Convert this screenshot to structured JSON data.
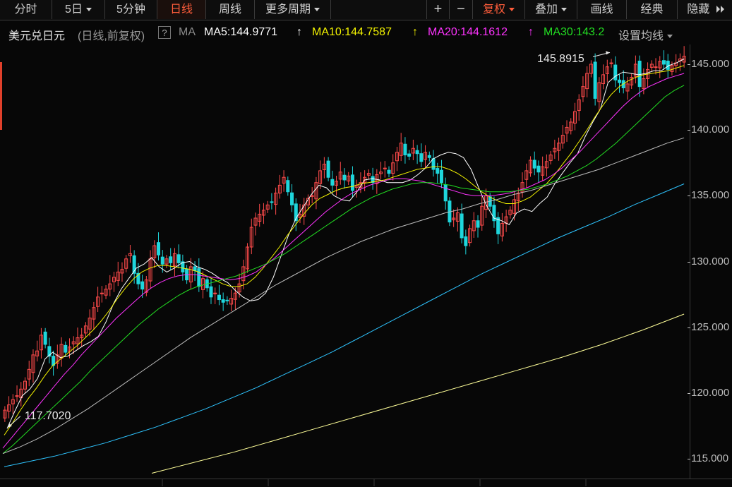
{
  "toolbar": {
    "left_buttons": [
      {
        "label": "分时",
        "dropdown": false,
        "active": false
      },
      {
        "label": "5日",
        "dropdown": true,
        "active": false
      },
      {
        "label": "5分钟",
        "dropdown": false,
        "active": false
      },
      {
        "label": "日线",
        "dropdown": false,
        "active": true
      },
      {
        "label": "周线",
        "dropdown": false,
        "active": false
      },
      {
        "label": "更多周期",
        "dropdown": true,
        "active": false
      }
    ],
    "zoom_in": "+",
    "zoom_out": "−",
    "right_buttons": [
      {
        "label": "复权",
        "dropdown": true,
        "accent": true
      },
      {
        "label": "叠加",
        "dropdown": true,
        "accent": false
      },
      {
        "label": "画线",
        "dropdown": false,
        "accent": false
      },
      {
        "label": "经典",
        "dropdown": false,
        "accent": false
      },
      {
        "label": "隐藏",
        "dropdown": false,
        "accent": false
      }
    ],
    "collapse_icon": "double-chevron-right"
  },
  "info": {
    "instrument": "美元兑日元",
    "period_note": "(日线,前复权)",
    "help": "?",
    "ma_label": "MA",
    "ma_items": [
      {
        "text": "MA5:144.9771",
        "color": "#ffffff"
      },
      {
        "text": "MA10:144.7587",
        "color": "#f2f200"
      },
      {
        "text": "MA20:144.1612",
        "color": "#ff33ff"
      },
      {
        "text": "MA30:143.2",
        "color": "#22dd22"
      }
    ],
    "settings_label": "设置均线",
    "arrow_icon": "up-arrow"
  },
  "colors": {
    "up": "#ff4b4b",
    "down": "#1ed6dc",
    "ma5": "#ffffff",
    "ma10": "#f2f200",
    "ma20": "#ff33ff",
    "ma30": "#22dd22",
    "ma60": "#bdbdbd",
    "ma120": "#2ec4ff",
    "ma250": "#ffff99"
  },
  "chart_data": {
    "type": "candlestick",
    "title": "美元兑日元",
    "ylim": [
      113.5,
      146.5
    ],
    "y_ticks": [
      "145.000",
      "140.000",
      "135.000",
      "130.000",
      "125.000",
      "120.000",
      "115.000"
    ],
    "y_tick_values": [
      145,
      140,
      135,
      130,
      125,
      120,
      115
    ],
    "annotations": {
      "high": {
        "value": 145.8915,
        "label": "145.8915",
        "bar": 150
      },
      "low": {
        "value": 117.702,
        "label": "117.7020",
        "bar": 0
      }
    },
    "closes": [
      118.7,
      119.1,
      119.5,
      119.8,
      120.3,
      120.9,
      121.8,
      122.9,
      123.2,
      124.4,
      123.7,
      122.8,
      122.1,
      122.9,
      123.7,
      123.1,
      123.5,
      123.9,
      124.2,
      124.4,
      125.1,
      125.7,
      126.5,
      127.3,
      127.6,
      127.9,
      128.3,
      128.8,
      129.2,
      129.4,
      130.2,
      130.6,
      129.1,
      128.3,
      127.9,
      128.6,
      130.2,
      131.2,
      130.5,
      129.8,
      130.2,
      129.9,
      130.6,
      129.9,
      129.2,
      128.6,
      129.6,
      129.3,
      128.1,
      128.7,
      128.0,
      127.3,
      127.6,
      127.1,
      126.9,
      127.0,
      127.2,
      127.6,
      128.3,
      129.6,
      131.1,
      132.6,
      133.3,
      133.6,
      133.9,
      134.3,
      134.5,
      135.2,
      135.8,
      136.4,
      135.3,
      134.3,
      133.1,
      133.6,
      134.3,
      134.8,
      135.0,
      136.0,
      136.9,
      137.4,
      136.4,
      135.8,
      136.1,
      136.8,
      136.2,
      136.5,
      135.4,
      135.8,
      136.0,
      136.4,
      136.7,
      136.0,
      136.6,
      136.8,
      137.1,
      136.7,
      137.5,
      138.3,
      139.0,
      138.1,
      138.0,
      138.6,
      138.2,
      137.6,
      138.3,
      137.9,
      137.0,
      136.7,
      136.0,
      134.6,
      133.0,
      133.3,
      133.7,
      131.8,
      131.2,
      132.5,
      133.1,
      132.6,
      134.2,
      135.0,
      134.2,
      133.1,
      132.1,
      132.9,
      133.4,
      133.9,
      134.7,
      135.2,
      136.0,
      136.9,
      137.7,
      137.1,
      136.8,
      137.2,
      137.6,
      138.1,
      138.6,
      139.0,
      139.6,
      140.2,
      140.6,
      141.4,
      142.3,
      143.3,
      144.3,
      145.0,
      142.4,
      143.6,
      144.2,
      144.8,
      145.1,
      143.8,
      143.6,
      143.2,
      143.5,
      144.0,
      145.0,
      143.3,
      143.9,
      144.6,
      145.0,
      144.8,
      145.2,
      145.0,
      144.6,
      144.9,
      145.1,
      145.4,
      145.6
    ],
    "series": [
      {
        "name": "MA5",
        "values": [
          117.3,
          118.6,
          119.8,
          120.3,
          121.1,
          122.6,
          123.1,
          122.7,
          122.8,
          123.2,
          123.6,
          123.9,
          124.3,
          125.4,
          126.8,
          127.9,
          128.7,
          129.5,
          129.8,
          130.3,
          129.6,
          129.2,
          129.5,
          129.9,
          130.0,
          129.6,
          129.4,
          129.1,
          128.7,
          128.4,
          127.8,
          127.3,
          127.0,
          127.1,
          127.6,
          128.8,
          130.4,
          132.0,
          133.3,
          134.2,
          135.1,
          135.8,
          135.6,
          135.0,
          134.7,
          134.6,
          135.3,
          136.2,
          136.3,
          136.2,
          136.0,
          136.0,
          136.0,
          136.2,
          136.6,
          137.1,
          137.8,
          138.1,
          138.3,
          138.2,
          137.9,
          137.0,
          135.6,
          134.3,
          133.3,
          133.1,
          132.8,
          133.7,
          134.0,
          133.8,
          134.4,
          134.9,
          135.9,
          136.7,
          137.5,
          138.2,
          139.5,
          140.6,
          141.6,
          143.6,
          144.1,
          144.4,
          144.3,
          144.2,
          144.3,
          144.5,
          144.5,
          144.9,
          145.1,
          145.4
        ]
      },
      {
        "name": "MA10",
        "values": [
          116.8,
          117.7,
          118.7,
          119.6,
          120.4,
          121.3,
          122.1,
          122.6,
          123.1,
          123.6,
          124.2,
          124.8,
          125.5,
          126.3,
          127.2,
          128.0,
          128.7,
          129.2,
          129.5,
          129.7,
          129.7,
          129.6,
          129.5,
          129.4,
          129.2,
          128.9,
          128.6,
          128.3,
          128.1,
          128.1,
          128.3,
          128.8,
          129.5,
          130.3,
          131.1,
          132.0,
          132.8,
          133.6,
          134.3,
          134.8,
          135.1,
          135.4,
          135.6,
          135.7,
          135.9,
          136.0,
          136.1,
          136.2,
          136.4,
          136.6,
          136.8,
          137.0,
          137.1,
          137.2,
          137.2,
          137.0,
          136.7,
          136.3,
          135.8,
          135.3,
          134.9,
          134.6,
          134.4,
          134.4,
          134.6,
          134.9,
          135.4,
          135.9,
          136.6,
          137.4,
          138.2,
          139.1,
          140.0,
          141.0,
          141.9,
          142.7,
          143.3,
          143.7,
          144.0,
          144.2,
          144.3,
          144.4,
          144.5,
          144.7,
          144.9
        ]
      },
      {
        "name": "MA20",
        "values": [
          115.8,
          116.6,
          117.4,
          118.2,
          119.0,
          119.8,
          120.6,
          121.4,
          122.1,
          122.9,
          123.6,
          124.3,
          125.0,
          125.7,
          126.3,
          126.9,
          127.5,
          128.0,
          128.4,
          128.7,
          128.9,
          129.0,
          129.0,
          128.9,
          128.8,
          128.7,
          128.6,
          128.7,
          128.9,
          129.2,
          129.7,
          130.2,
          130.8,
          131.4,
          132.0,
          132.6,
          133.2,
          133.8,
          134.3,
          134.8,
          135.2,
          135.5,
          135.8,
          136.0,
          136.2,
          136.3,
          136.3,
          136.2,
          136.1,
          135.9,
          135.7,
          135.5,
          135.3,
          135.1,
          135.0,
          135.0,
          135.0,
          135.1,
          135.2,
          135.4,
          135.6,
          135.9,
          136.2,
          136.6,
          137.1,
          137.7,
          138.3,
          139.0,
          139.7,
          140.4,
          141.1,
          141.8,
          142.4,
          142.9,
          143.3,
          143.6,
          143.9,
          144.1,
          144.3
        ]
      },
      {
        "name": "MA30",
        "values": [
          115.4,
          116.0,
          116.7,
          117.4,
          118.1,
          118.8,
          119.5,
          120.2,
          120.9,
          121.7,
          122.4,
          123.1,
          123.8,
          124.5,
          125.2,
          125.8,
          126.4,
          126.9,
          127.4,
          127.8,
          128.1,
          128.3,
          128.5,
          128.7,
          128.9,
          129.2,
          129.5,
          129.8,
          130.2,
          130.6,
          131.1,
          131.6,
          132.1,
          132.6,
          133.1,
          133.6,
          134.1,
          134.5,
          134.9,
          135.2,
          135.5,
          135.7,
          135.9,
          136.0,
          136.0,
          135.9,
          135.8,
          135.6,
          135.5,
          135.4,
          135.3,
          135.3,
          135.3,
          135.4,
          135.5,
          135.7,
          135.9,
          136.2,
          136.5,
          136.9,
          137.3,
          137.8,
          138.4,
          139.0,
          139.7,
          140.4,
          141.1,
          141.8,
          142.5,
          143.0,
          143.4
        ]
      },
      {
        "name": "MA60",
        "values": [
          115.4,
          115.9,
          116.5,
          117.2,
          118.0,
          118.8,
          119.7,
          120.6,
          121.5,
          122.4,
          123.3,
          124.2,
          125.0,
          125.8,
          126.6,
          127.4,
          128.2,
          128.9,
          129.6,
          130.3,
          130.9,
          131.5,
          132.0,
          132.5,
          132.9,
          133.3,
          133.7,
          134.0,
          134.4,
          134.7,
          135.1,
          135.4,
          135.8,
          136.2,
          136.6,
          137.0,
          137.5,
          138.0,
          138.5,
          139.0,
          139.4
        ]
      },
      {
        "name": "MA120",
        "values": [
          114.4,
          114.8,
          115.2,
          115.7,
          116.2,
          116.8,
          117.4,
          118.1,
          118.8,
          119.6,
          120.4,
          121.3,
          122.2,
          123.1,
          124.1,
          125.1,
          126.1,
          127.1,
          128.1,
          129.1,
          130.0,
          130.9,
          131.8,
          132.6,
          133.4,
          134.3,
          135.1,
          135.9
        ]
      },
      {
        "name": "MA250",
        "values": [
          113.9,
          114.7,
          115.5,
          116.4,
          117.3,
          118.2,
          119.1,
          120.0,
          120.9,
          121.8,
          122.7,
          123.7,
          124.8,
          126.0
        ]
      }
    ]
  }
}
